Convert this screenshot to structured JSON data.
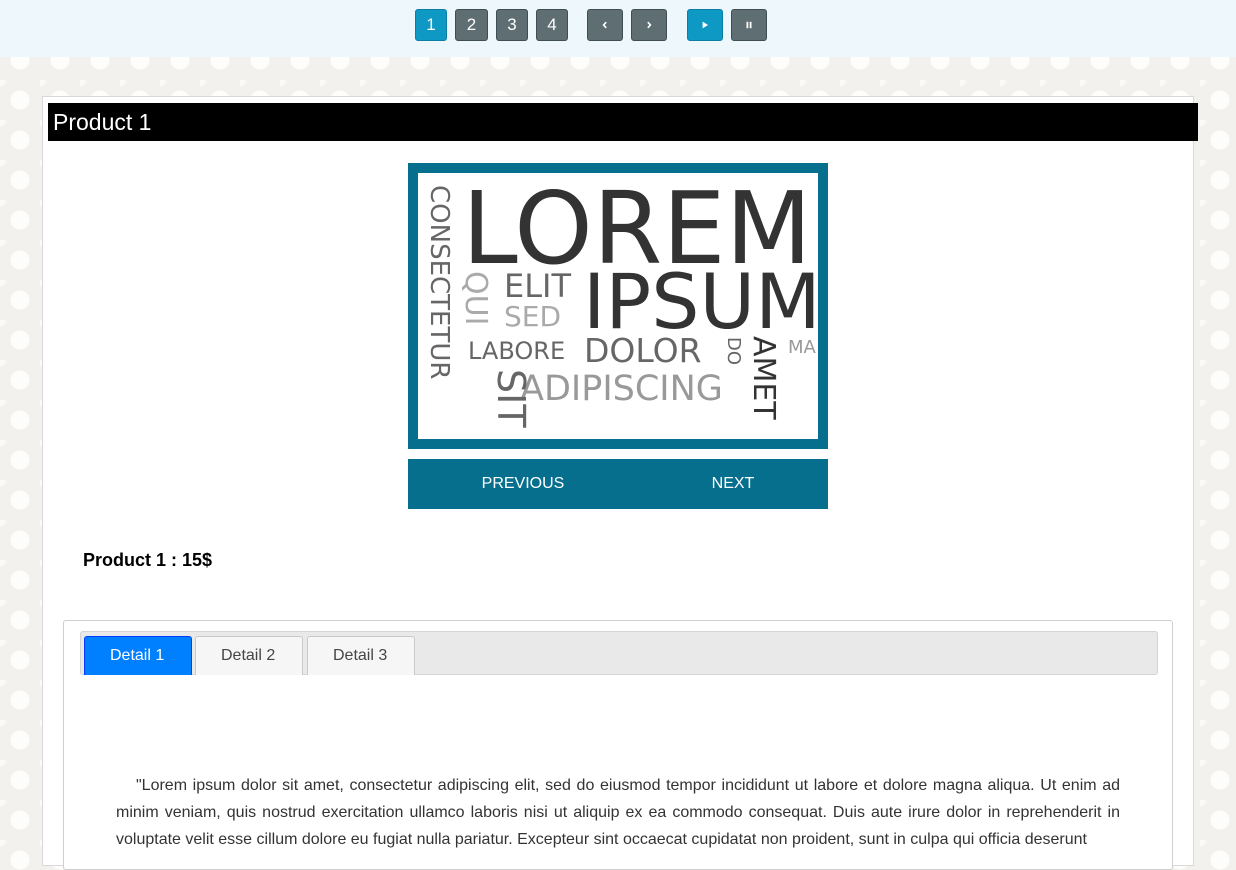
{
  "pagination": {
    "pages": [
      "1",
      "2",
      "3",
      "4"
    ],
    "active_page": "1",
    "prev_icon": "chevron-left-icon",
    "next_icon": "chevron-right-icon",
    "play_icon": "play-icon",
    "pause_icon": "pause-icon"
  },
  "product": {
    "title": "Product 1",
    "price_line": "Product 1 : 15$"
  },
  "slider": {
    "image_words": {
      "lorem": "LOREM",
      "ipsum": "IPSUM",
      "elit": "ELIT",
      "sed": "SED",
      "qui": "QUI",
      "labore": "LABORE",
      "dolor": "DOLOR",
      "do": "DO",
      "adipiscing": "ADIPISCING",
      "sit": "SIT",
      "amet": "AMET",
      "consectetur": "CONSECTETUR",
      "ma": "MA"
    },
    "previous_label": "PREVIOUS",
    "next_label": "NEXT"
  },
  "details": {
    "tabs": [
      {
        "label": "Detail 1",
        "active": true
      },
      {
        "label": "Detail 2",
        "active": false
      },
      {
        "label": "Detail 3",
        "active": false
      }
    ],
    "text": "\"Lorem ipsum dolor sit amet, consectetur adipiscing elit, sed do eiusmod tempor incididunt ut labore et dolore magna aliqua. Ut enim ad minim veniam, quis nostrud exercitation ullamco laboris nisi ut aliquip ex ea commodo consequat. Duis aute irure dolor in reprehenderit in voluptate velit esse cillum dolore eu fugiat nulla pariatur. Excepteur sint occaecat cupidatat non proident, sunt in culpa qui officia deserunt"
  },
  "colors": {
    "accent": "#066f8e",
    "active_page": "#0e99c4",
    "page_button": "#5f6e72",
    "active_tab": "#007fff"
  }
}
